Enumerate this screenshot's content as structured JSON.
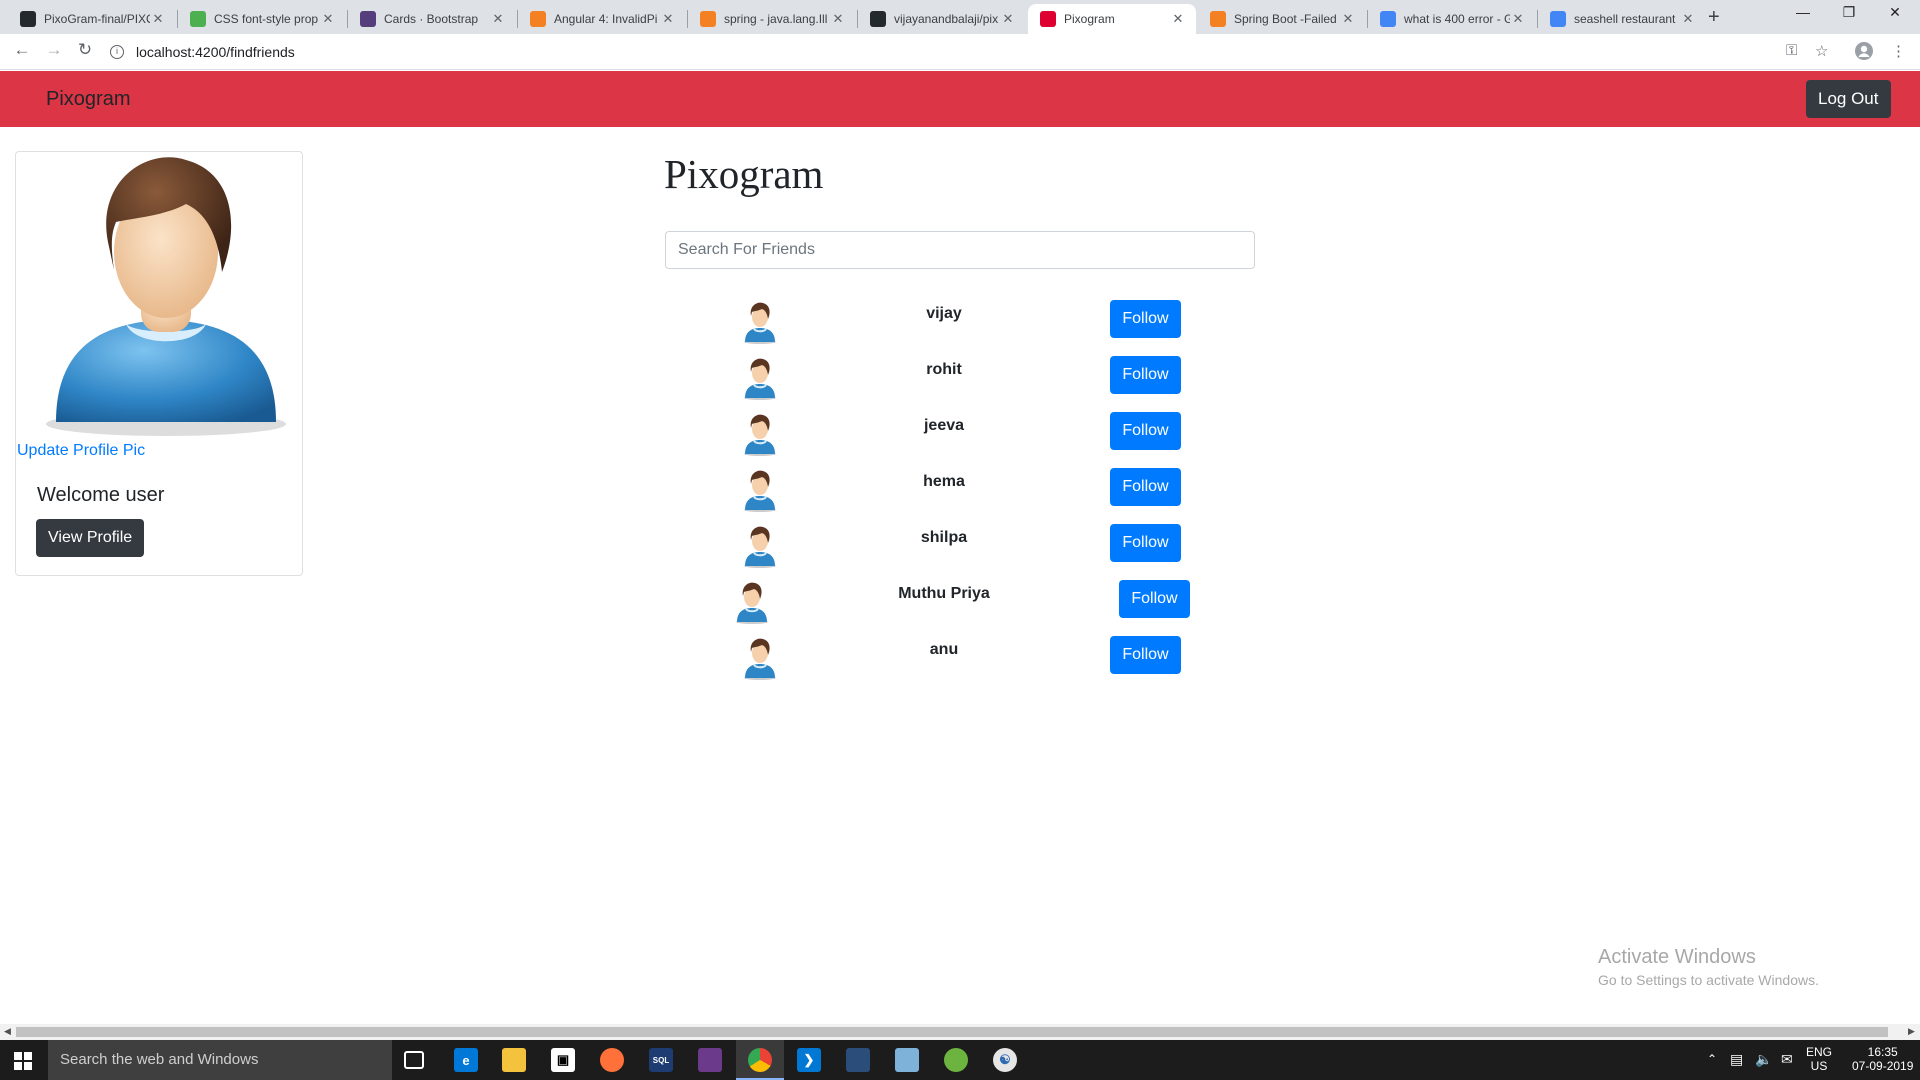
{
  "browser": {
    "tabs": [
      {
        "title": "PixoGram-final/PIXO",
        "icon": "github-icon",
        "color": "#24292e"
      },
      {
        "title": "CSS font-style prop",
        "icon": "w3schools-icon",
        "color": "#4caf50"
      },
      {
        "title": "Cards · Bootstrap",
        "icon": "bootstrap-icon",
        "color": "#563d7c"
      },
      {
        "title": "Angular 4: InvalidPi",
        "icon": "stackoverflow-icon",
        "color": "#f48024"
      },
      {
        "title": "spring - java.lang.Ill",
        "icon": "stackoverflow-icon",
        "color": "#f48024"
      },
      {
        "title": "vijayanandbalaji/pix",
        "icon": "github-icon",
        "color": "#24292e"
      },
      {
        "title": "Pixogram",
        "icon": "angular-icon",
        "color": "#dd0031"
      },
      {
        "title": "Spring Boot -Failed",
        "icon": "stackoverflow-icon",
        "color": "#f48024"
      },
      {
        "title": "what is 400 error - G",
        "icon": "google-icon",
        "color": "#4285f4"
      },
      {
        "title": "seashell restaurant",
        "icon": "google-icon",
        "color": "#4285f4"
      }
    ],
    "active_tab": 6,
    "url": "localhost:4200/findfriends"
  },
  "navbar": {
    "brand": "Pixogram",
    "logout_label": "Log Out",
    "color": "#dc3545"
  },
  "profile": {
    "update_pic_label": "Update Profile Pic",
    "welcome": "Welcome user",
    "view_profile_label": "View Profile"
  },
  "main": {
    "title": "Pixogram",
    "search_placeholder": "Search For Friends",
    "follow_label": "Follow",
    "friends": [
      {
        "name": "vijay"
      },
      {
        "name": "rohit"
      },
      {
        "name": "jeeva"
      },
      {
        "name": "hema"
      },
      {
        "name": "shilpa"
      },
      {
        "name": "Muthu Priya"
      },
      {
        "name": "anu"
      }
    ]
  },
  "watermark": {
    "line1": "Activate Windows",
    "line2": "Go to Settings to activate Windows."
  },
  "taskbar": {
    "search_placeholder": "Search the web and Windows",
    "lang1": "ENG",
    "lang2": "US",
    "time": "16:35",
    "date": "07-09-2019"
  }
}
